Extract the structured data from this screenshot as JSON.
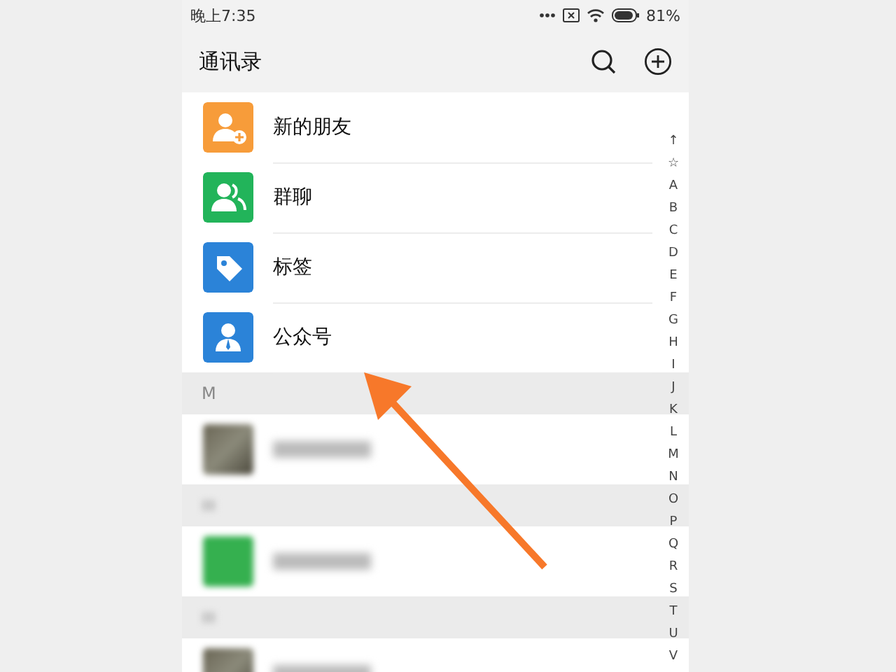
{
  "status_bar": {
    "time": "晚上7:35",
    "battery": "81%"
  },
  "header": {
    "title": "通讯录"
  },
  "quick_entries": [
    {
      "label": "新的朋友",
      "kind": "new-friend",
      "color": "#f79c3a"
    },
    {
      "label": "群聊",
      "kind": "group",
      "color": "#22b45a"
    },
    {
      "label": "标签",
      "kind": "tag",
      "color": "#2b83d8"
    },
    {
      "label": "公众号",
      "kind": "official",
      "color": "#2b83d8"
    }
  ],
  "contacts": [
    {
      "kind": "header",
      "letter": "M"
    },
    {
      "kind": "photo-contact"
    },
    {
      "kind": "header"
    },
    {
      "kind": "logo-contact"
    },
    {
      "kind": "header"
    },
    {
      "kind": "photo-contact"
    }
  ],
  "index_bar": [
    "↑",
    "☆",
    "A",
    "B",
    "C",
    "D",
    "E",
    "F",
    "G",
    "H",
    "I",
    "J",
    "K",
    "L",
    "M",
    "N",
    "O",
    "P",
    "Q",
    "R",
    "S",
    "T",
    "U",
    "V"
  ]
}
